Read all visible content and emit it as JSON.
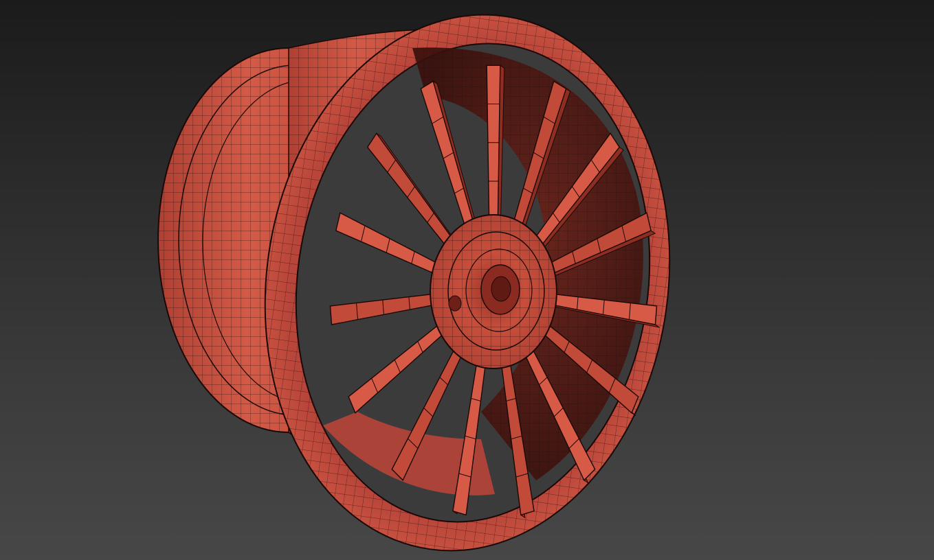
{
  "viewport": {
    "background_top": "#1b1b1b",
    "background_bottom": "#474747"
  },
  "model": {
    "object": "wheel-rim",
    "spoke_count": 15,
    "shading": "wireframe-on-shaded",
    "colors": {
      "surface": "#c24a38",
      "surface_light": "#d65a45",
      "surface_dark": "#8e2d22",
      "wire": "#1a0806"
    }
  }
}
